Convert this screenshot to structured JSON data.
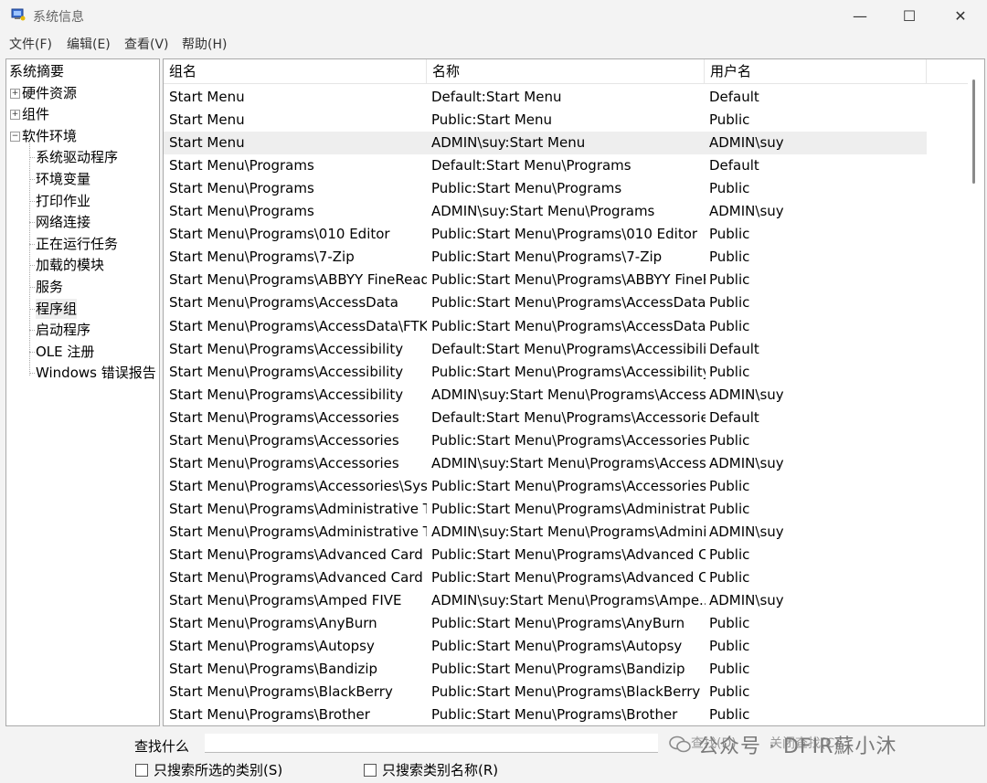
{
  "window": {
    "title": "系统信息",
    "minimize": "—",
    "maximize": "☐",
    "close": "✕"
  },
  "menu": [
    "文件(F)",
    "编辑(E)",
    "查看(V)",
    "帮助(H)"
  ],
  "tree": [
    {
      "label": "系统摘要"
    },
    {
      "label": "硬件资源",
      "expander": "+"
    },
    {
      "label": "组件",
      "expander": "+"
    },
    {
      "label": "软件环境",
      "expander": "−"
    },
    {
      "label": "系统驱动程序"
    },
    {
      "label": "环境变量"
    },
    {
      "label": "打印作业"
    },
    {
      "label": "网络连接"
    },
    {
      "label": "正在运行任务"
    },
    {
      "label": "加载的模块"
    },
    {
      "label": "服务"
    },
    {
      "label": "程序组",
      "selected": true
    },
    {
      "label": "启动程序"
    },
    {
      "label": "OLE 注册"
    },
    {
      "label": "Windows 错误报告"
    }
  ],
  "columns": [
    "组名",
    "名称",
    "用户名"
  ],
  "rows": [
    [
      "Start Menu",
      "Default:Start Menu",
      "Default"
    ],
    [
      "Start Menu",
      "Public:Start Menu",
      "Public"
    ],
    [
      "Start Menu",
      "ADMIN\\suy:Start Menu",
      "ADMIN\\suy"
    ],
    [
      "Start Menu\\Programs",
      "Default:Start Menu\\Programs",
      "Default"
    ],
    [
      "Start Menu\\Programs",
      "Public:Start Menu\\Programs",
      "Public"
    ],
    [
      "Start Menu\\Programs",
      "ADMIN\\suy:Start Menu\\Programs",
      "ADMIN\\suy"
    ],
    [
      "Start Menu\\Programs\\010 Editor",
      "Public:Start Menu\\Programs\\010 Editor",
      "Public"
    ],
    [
      "Start Menu\\Programs\\7-Zip",
      "Public:Start Menu\\Programs\\7-Zip",
      "Public"
    ],
    [
      "Start Menu\\Programs\\ABBYY FineReade...",
      "Public:Start Menu\\Programs\\ABBYY FineR...",
      "Public"
    ],
    [
      "Start Menu\\Programs\\AccessData",
      "Public:Start Menu\\Programs\\AccessData",
      "Public"
    ],
    [
      "Start Menu\\Programs\\AccessData\\FTK I...",
      "Public:Start Menu\\Programs\\AccessData\\...",
      "Public"
    ],
    [
      "Start Menu\\Programs\\Accessibility",
      "Default:Start Menu\\Programs\\Accessibility",
      "Default"
    ],
    [
      "Start Menu\\Programs\\Accessibility",
      "Public:Start Menu\\Programs\\Accessibility",
      "Public"
    ],
    [
      "Start Menu\\Programs\\Accessibility",
      "ADMIN\\suy:Start Menu\\Programs\\Accessi...",
      "ADMIN\\suy"
    ],
    [
      "Start Menu\\Programs\\Accessories",
      "Default:Start Menu\\Programs\\Accessories",
      "Default"
    ],
    [
      "Start Menu\\Programs\\Accessories",
      "Public:Start Menu\\Programs\\Accessories",
      "Public"
    ],
    [
      "Start Menu\\Programs\\Accessories",
      "ADMIN\\suy:Start Menu\\Programs\\Access...",
      "ADMIN\\suy"
    ],
    [
      "Start Menu\\Programs\\Accessories\\Syst...",
      "Public:Start Menu\\Programs\\Accessories\\...",
      "Public"
    ],
    [
      "Start Menu\\Programs\\Administrative T...",
      "Public:Start Menu\\Programs\\Administrati...",
      "Public"
    ],
    [
      "Start Menu\\Programs\\Administrative T...",
      "ADMIN\\suy:Start Menu\\Programs\\Admini...",
      "ADMIN\\suy"
    ],
    [
      "Start Menu\\Programs\\Advanced Card S...",
      "Public:Start Menu\\Programs\\Advanced C...",
      "Public"
    ],
    [
      "Start Menu\\Programs\\Advanced Card S...",
      "Public:Start Menu\\Programs\\Advanced C...",
      "Public"
    ],
    [
      "Start Menu\\Programs\\Amped FIVE",
      "ADMIN\\suy:Start Menu\\Programs\\Ampe...",
      "ADMIN\\suy"
    ],
    [
      "Start Menu\\Programs\\AnyBurn",
      "Public:Start Menu\\Programs\\AnyBurn",
      "Public"
    ],
    [
      "Start Menu\\Programs\\Autopsy",
      "Public:Start Menu\\Programs\\Autopsy",
      "Public"
    ],
    [
      "Start Menu\\Programs\\Bandizip",
      "Public:Start Menu\\Programs\\Bandizip",
      "Public"
    ],
    [
      "Start Menu\\Programs\\BlackBerry",
      "Public:Start Menu\\Programs\\BlackBerry",
      "Public"
    ],
    [
      "Start Menu\\Programs\\Brother",
      "Public:Start Menu\\Programs\\Brother",
      "Public"
    ]
  ],
  "selected_row": 2,
  "find": {
    "label": "查找什么",
    "value": "",
    "find_button": "查找(D)",
    "close_find_button": "关闭查找(C)",
    "check_selected": "只搜索所选的类别(S)",
    "check_names": "只搜索类别名称(R)"
  },
  "watermark": "公众号 · DFIR蘇小沐",
  "colors": {
    "window_bg": "#f3f3f3",
    "panel_bg": "#ffffff",
    "selected_row_bg": "#eeeeee",
    "border": "#a9a9a9"
  }
}
